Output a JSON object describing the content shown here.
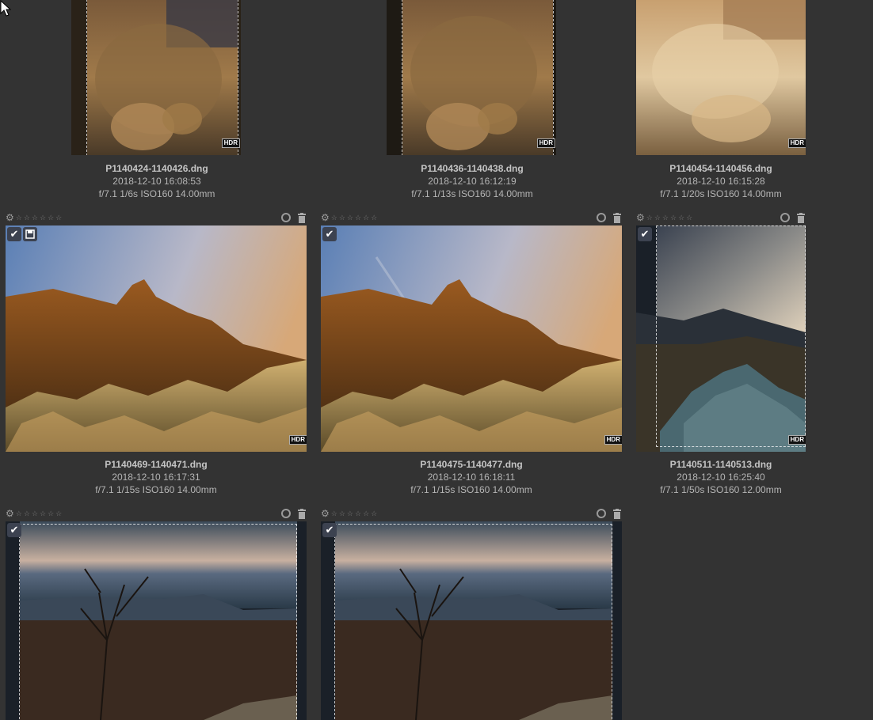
{
  "colors": {
    "background": "#333333",
    "text": "#b5b5b5",
    "filename": "#c4c4c4",
    "badge": "#3c4250"
  },
  "icons": {
    "gear": "gear-icon",
    "star": "star-icon",
    "reject": "circle-icon",
    "delete": "trash-icon",
    "selected": "check-icon",
    "saved": "save-icon",
    "hdr": "hdr-badge"
  },
  "hdr_label": "HDR",
  "thumbnails": [
    {
      "filename": "P1140424-1140426.dng",
      "datetime": "2018-12-10 16:08:53",
      "exif": "f/7.1 1/6s ISO160 14.00mm",
      "hdr": true,
      "selected": false
    },
    {
      "filename": "P1140436-1140438.dng",
      "datetime": "2018-12-10 16:12:19",
      "exif": "f/7.1 1/13s ISO160 14.00mm",
      "hdr": true,
      "selected": false
    },
    {
      "filename": "P1140454-1140456.dng",
      "datetime": "2018-12-10 16:15:28",
      "exif": "f/7.1 1/20s ISO160 14.00mm",
      "hdr": true,
      "selected": false
    },
    {
      "filename": "P1140469-1140471.dng",
      "datetime": "2018-12-10 16:17:31",
      "exif": "f/7.1 1/15s ISO160 14.00mm",
      "hdr": true,
      "selected": true
    },
    {
      "filename": "P1140475-1140477.dng",
      "datetime": "2018-12-10 16:18:11",
      "exif": "f/7.1 1/15s ISO160 14.00mm",
      "hdr": true,
      "selected": true
    },
    {
      "filename": "P1140511-1140513.dng",
      "datetime": "2018-12-10 16:25:40",
      "exif": "f/7.1 1/50s ISO160 12.00mm",
      "hdr": true,
      "selected": true
    },
    {
      "filename": "",
      "datetime": "",
      "exif": "",
      "hdr": false,
      "selected": true
    },
    {
      "filename": "",
      "datetime": "",
      "exif": "",
      "hdr": false,
      "selected": true
    }
  ]
}
